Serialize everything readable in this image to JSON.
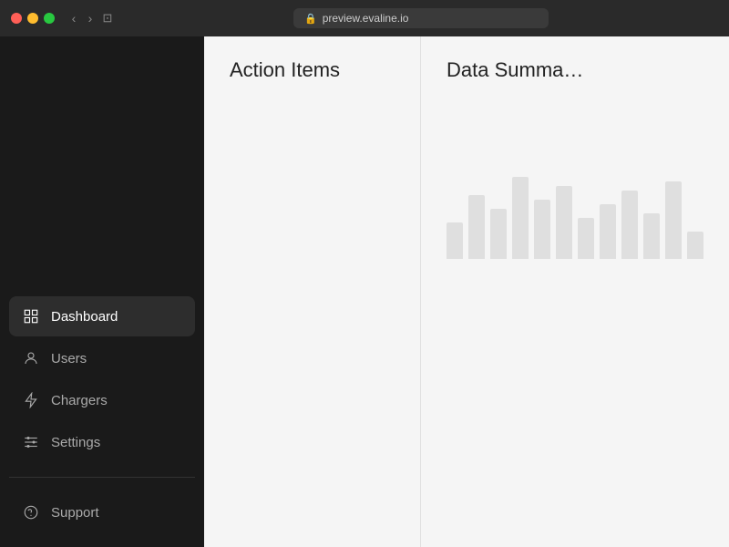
{
  "window": {
    "url": "preview.evaline.io"
  },
  "sidebar": {
    "nav_items": [
      {
        "id": "dashboard",
        "label": "Dashboard",
        "icon": "dashboard-icon",
        "active": true
      },
      {
        "id": "users",
        "label": "Users",
        "icon": "users-icon",
        "active": false
      },
      {
        "id": "chargers",
        "label": "Chargers",
        "icon": "chargers-icon",
        "active": false
      },
      {
        "id": "settings",
        "label": "Settings",
        "icon": "settings-icon",
        "active": false
      }
    ],
    "bottom_items": [
      {
        "id": "support",
        "label": "Support",
        "icon": "support-icon"
      }
    ]
  },
  "main": {
    "panels": [
      {
        "id": "action-items",
        "title": "Action Items"
      },
      {
        "id": "data-summary",
        "title": "Data Summa…"
      }
    ]
  },
  "chart": {
    "bars": [
      40,
      70,
      55,
      90,
      65,
      80,
      45,
      60,
      75,
      50,
      85,
      30
    ]
  }
}
